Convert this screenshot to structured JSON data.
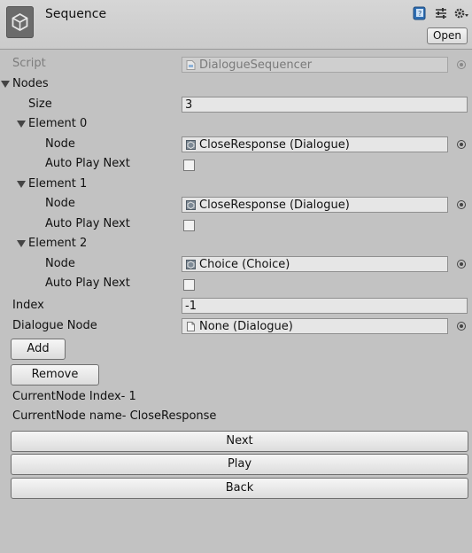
{
  "header": {
    "title": "Sequence",
    "open_label": "Open"
  },
  "script": {
    "label": "Script",
    "value": "DialogueSequencer"
  },
  "nodes": {
    "label": "Nodes",
    "size_label": "Size",
    "size_value": "3",
    "elements": [
      {
        "label": "Element 0",
        "node_label": "Node",
        "node_value": "CloseResponse (Dialogue)",
        "auto_label": "Auto Play Next"
      },
      {
        "label": "Element 1",
        "node_label": "Node",
        "node_value": "CloseResponse (Dialogue)",
        "auto_label": "Auto Play Next"
      },
      {
        "label": "Element 2",
        "node_label": "Node",
        "node_value": "Choice (Choice)",
        "auto_label": "Auto Play Next"
      }
    ]
  },
  "index": {
    "label": "Index",
    "value": "-1"
  },
  "dialogue_node": {
    "label": "Dialogue Node",
    "value": "None (Dialogue)"
  },
  "buttons": {
    "add": "Add",
    "remove": "Remove",
    "next": "Next",
    "play": "Play",
    "back": "Back"
  },
  "status": {
    "current_index": "CurrentNode Index- 1",
    "current_name": "CurrentNode name- CloseResponse"
  },
  "colors": {
    "background": "#c2c2c2",
    "field": "#e6e6e6"
  }
}
